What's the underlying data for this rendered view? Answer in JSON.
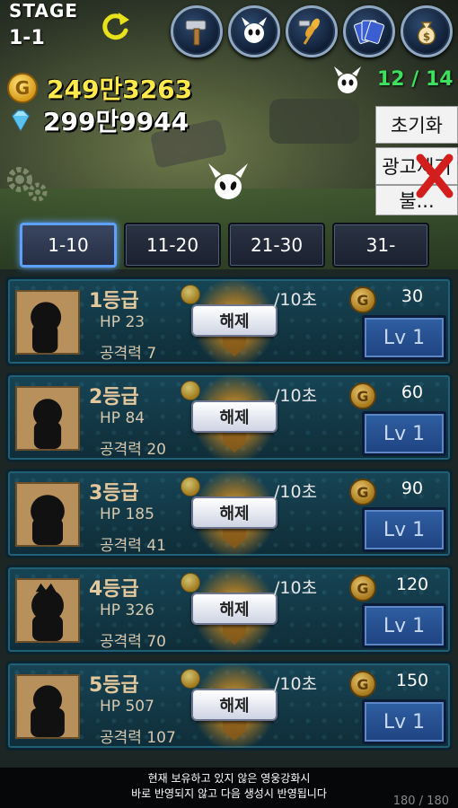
{
  "header": {
    "stage_label": "STAGE",
    "stage_number": "1-1"
  },
  "top_icons": [
    {
      "name": "hammer-icon"
    },
    {
      "name": "demon-face-icon"
    },
    {
      "name": "wheat-icon"
    },
    {
      "name": "cards-icon"
    },
    {
      "name": "money-bag-icon"
    }
  ],
  "resources": {
    "gold": "249만3263",
    "gems": "299만9944"
  },
  "kill_counter": "12 / 14",
  "side_menu": {
    "reset_label": "초기화",
    "ad_label": "광고제거",
    "third_label": "불..."
  },
  "tabs": [
    {
      "label": "1-10",
      "active": true
    },
    {
      "label": "11-20",
      "active": false
    },
    {
      "label": "21-30",
      "active": false
    },
    {
      "label": "31-",
      "active": false
    }
  ],
  "units": [
    {
      "grade": "1등급",
      "hp": "HP 23",
      "atk": "공격력 7",
      "release": "해제",
      "time": "/10초",
      "cost": "30",
      "level": "Lv 1"
    },
    {
      "grade": "2등급",
      "hp": "HP 84",
      "atk": "공격력 20",
      "release": "해제",
      "time": "/10초",
      "cost": "60",
      "level": "Lv 1"
    },
    {
      "grade": "3등급",
      "hp": "HP 185",
      "atk": "공격력 41",
      "release": "해제",
      "time": "/10초",
      "cost": "90",
      "level": "Lv 1"
    },
    {
      "grade": "4등급",
      "hp": "HP 326",
      "atk": "공격력 70",
      "release": "해제",
      "time": "/10초",
      "cost": "120",
      "level": "Lv 1"
    },
    {
      "grade": "5등급",
      "hp": "HP 507",
      "atk": "공격력 107",
      "release": "해제",
      "time": "/10초",
      "cost": "150",
      "level": "Lv 1"
    }
  ],
  "footer": {
    "line1": "현재 보유하고 있지 않은 영웅강화시",
    "line2": "바로 반영되지 않고 다음 생성시 반영됩니다",
    "count": "180 / 180"
  },
  "colors": {
    "gold_text": "#ffe94b",
    "kill_text": "#3ee15d",
    "tab_active_border": "#5ea0ff",
    "card_bg": "#174454",
    "level_button": "#2f5fa3"
  }
}
